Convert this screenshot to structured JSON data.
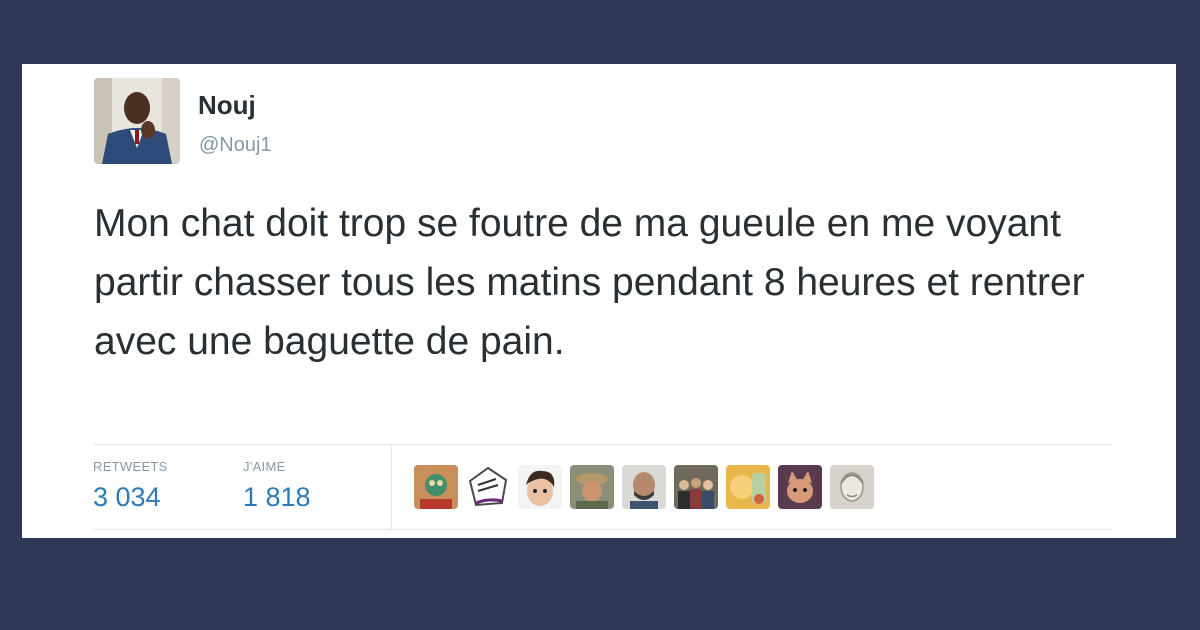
{
  "tweet": {
    "display_name": "Nouj",
    "handle": "@Nouj1",
    "text": "Mon chat doit trop se foutre de ma gueule en me voyant partir chasser tous les matins pendant 8 heures et rentrer avec une baguette de pain."
  },
  "stats": {
    "retweets_label": "RETWEETS",
    "retweets_value": "3 034",
    "likes_label": "J'AIME",
    "likes_value": "1 818"
  },
  "colors": {
    "page_background": "#2f3856",
    "card_background": "#ffffff",
    "text": "#292f33",
    "muted": "#8899a6",
    "accent": "#2b7bb9"
  }
}
